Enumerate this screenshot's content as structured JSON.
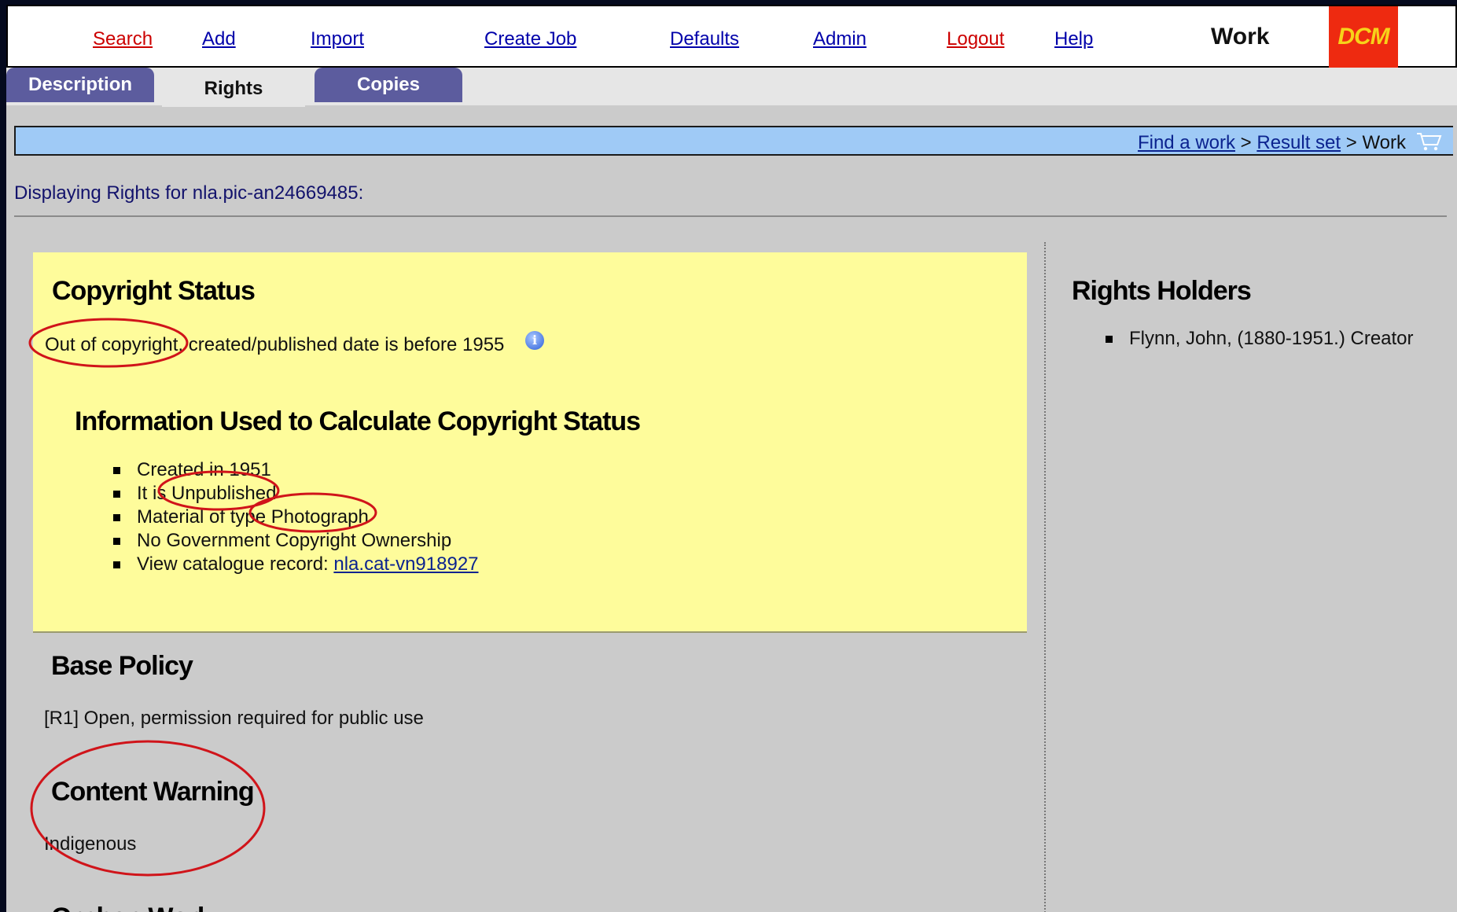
{
  "nav": {
    "items": [
      {
        "label": "Search",
        "color": "red"
      },
      {
        "label": "Add",
        "color": "blue"
      },
      {
        "label": "Import",
        "color": "blue"
      },
      {
        "label": "Create Job",
        "color": "blue"
      },
      {
        "label": "Defaults",
        "color": "blue"
      },
      {
        "label": "Admin",
        "color": "blue"
      },
      {
        "label": "Logout",
        "color": "red"
      },
      {
        "label": "Help",
        "color": "blue"
      }
    ],
    "title": "Work",
    "logo_text": "DCM"
  },
  "tabs": [
    {
      "label": "Description",
      "active": false
    },
    {
      "label": "Rights",
      "active": true
    },
    {
      "label": "Copies",
      "active": false
    }
  ],
  "breadcrumb": {
    "link1": "Find a work",
    "sep1": ">",
    "link2": "Result set",
    "sep2": ">",
    "current": "Work",
    "cart_icon": "shopping-cart-icon"
  },
  "display_line": "Displaying Rights for nla.pic-an24669485:",
  "copyright": {
    "heading": "Copyright Status",
    "status_emph": "Out of copyright",
    "status_rest": ", created/published date is before 1955",
    "info_icon": "info-icon",
    "sub_heading": "Information Used to Calculate Copyright Status",
    "items": [
      "Created in 1951",
      "It is Unpublished",
      "Material of type Photograph",
      "No Government Copyright Ownership"
    ],
    "catalogue_label": "View catalogue record:",
    "catalogue_link": "nla.cat-vn918927"
  },
  "base_policy": {
    "heading": "Base Policy",
    "text": "[R1] Open, permission required for public use"
  },
  "content_warning": {
    "heading": "Content Warning",
    "text": "Indigenous"
  },
  "orphan_work": {
    "heading": "Orphan Work"
  },
  "rights_holders": {
    "heading": "Rights Holders",
    "items": [
      "Flynn, John, (1880-1951.) Creator"
    ]
  },
  "colors": {
    "annotation": "#d0141a",
    "panel_yellow": "#fefc9b",
    "tab_purple": "#5c5c9e",
    "breadcrumb_blue": "#9fcaf6",
    "logo_red": "#ee2a10"
  }
}
